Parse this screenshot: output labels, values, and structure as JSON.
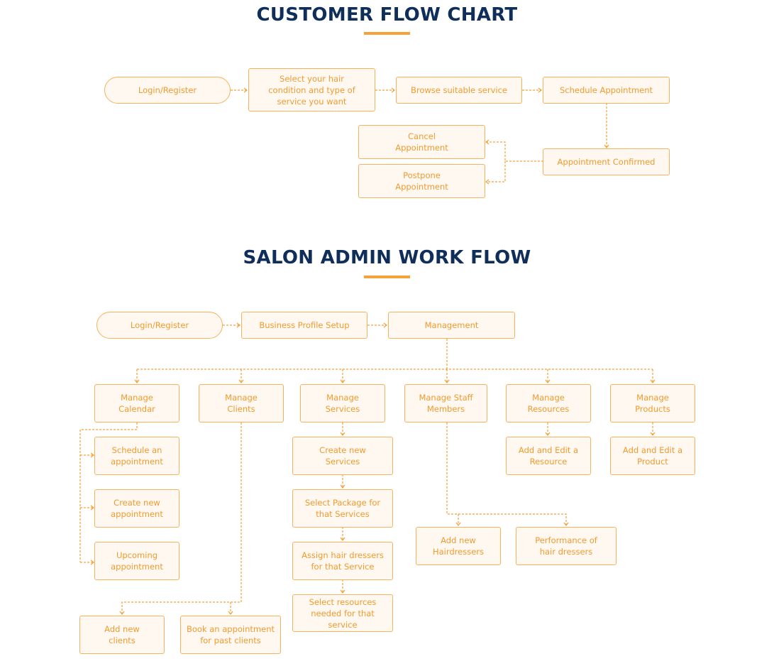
{
  "customer_flow": {
    "title": "CUSTOMER FLOW CHART",
    "nodes": {
      "login": "Login/Register",
      "select_hair": "Select your hair condition and type of service you want",
      "browse": "Browse suitable service",
      "schedule": "Schedule Appointment",
      "confirmed": "Appointment Confirmed",
      "cancel": "Cancel Appointment",
      "postpone": "Postpone Appointment"
    }
  },
  "admin_flow": {
    "title": "SALON ADMIN WORK FLOW",
    "nodes": {
      "login": "Login/Register",
      "profile": "Business Profile Setup",
      "management": "Management",
      "calendar": "Manage Calendar",
      "clients": "Manage Clients",
      "services": "Manage Services",
      "staff": "Manage Staff Members",
      "resources": "Manage Resources",
      "products": "Manage Products",
      "schedule_appt": "Schedule an appointment",
      "create_appt": "Create new appointment",
      "upcoming_appt": "Upcoming appointment",
      "create_services": "Create new Services",
      "select_package": "Select Package for that Services",
      "assign_dressers": "Assign hair dressers for that Service",
      "select_resources": "Select resources needed for that service",
      "add_resource": "Add and Edit a Resource",
      "add_product": "Add and Edit a Product",
      "add_hairdressers": "Add new Hairdressers",
      "performance": "Performance of hair dressers",
      "add_clients": "Add new clients",
      "book_past": "Book an appointment for past clients"
    }
  }
}
